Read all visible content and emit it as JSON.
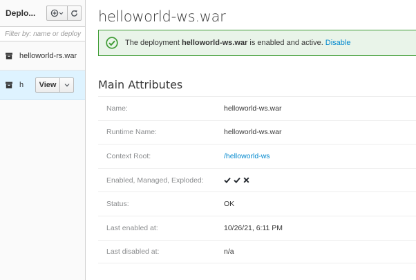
{
  "sidebar": {
    "title": "Deplo...",
    "add_button_icon": "plus-circle-icon",
    "refresh_button_icon": "refresh-icon",
    "filter_placeholder": "Filter by: name or deploy",
    "items": [
      {
        "label": "helloworld-rs.war",
        "icon": "archive-icon",
        "selected": false
      },
      {
        "label": "h",
        "icon": "archive-icon",
        "selected": true,
        "action_label": "View"
      }
    ]
  },
  "main": {
    "title": "helloworld-ws.war",
    "alert": {
      "prefix": "The deployment",
      "name": "helloworld-ws.war",
      "suffix": "is enabled and active.",
      "link": "Disable",
      "icon": "ok-circle-icon",
      "color": "#3f9c35"
    },
    "section_title": "Main Attributes",
    "attributes": [
      {
        "label": "Name:",
        "value": "helloworld-ws.war"
      },
      {
        "label": "Runtime Name:",
        "value": "helloworld-ws.war"
      },
      {
        "label": "Context Root:",
        "value": "/helloworld-ws",
        "is_link": true
      },
      {
        "label": "Enabled, Managed, Exploded:",
        "flags": [
          "check",
          "check",
          "cross"
        ]
      },
      {
        "label": "Status:",
        "value": "OK"
      },
      {
        "label": "Last enabled at:",
        "value": "10/26/21, 6:11 PM"
      },
      {
        "label": "Last disabled at:",
        "value": "n/a"
      }
    ]
  },
  "colors": {
    "accent": "#0088ce",
    "success": "#3f9c35",
    "selected_bg": "#def3ff"
  }
}
